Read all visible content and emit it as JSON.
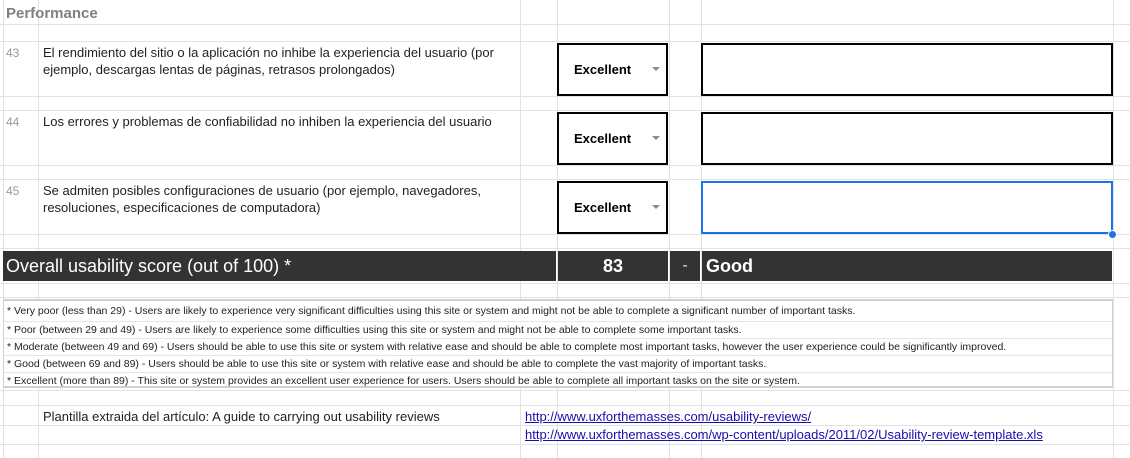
{
  "section": {
    "title": "Performance"
  },
  "rows": [
    {
      "num": "43",
      "text": "El rendimiento del sitio o la aplicación no inhibe la experiencia del usuario (por ejemplo, descargas lentas de páginas, retrasos prolongados)",
      "rating": "Excellent",
      "comment": ""
    },
    {
      "num": "44",
      "text": "Los errores y problemas de confiabilidad no inhiben la experiencia del usuario",
      "rating": "Excellent",
      "comment": ""
    },
    {
      "num": "45",
      "text": "Se admiten posibles configuraciones de usuario (por ejemplo, navegadores, resoluciones, especificaciones de computadora)",
      "rating": "Excellent",
      "comment": ""
    }
  ],
  "score": {
    "label": "Overall usability score (out of 100) *",
    "value": "83",
    "dash": "-",
    "rating": "Good"
  },
  "legend": [
    "* Very poor (less than 29) - Users are likely to experience very significant difficulties using this site or system and might not be able to complete a significant number of important tasks.",
    "* Poor (between 29 and 49) - Users are likely to experience some difficulties using this site or system and might not be able to complete some important tasks.",
    "* Moderate (between 49 and 69) - Users should be able to use this site or system with relative ease and should be able to complete most important tasks, however the user experience could be significantly improved.",
    "* Good (between 69 and 89) - Users should be able to use this site or system with relative ease and should be able to complete the vast majority of important tasks.",
    "* Excellent (more than 89) - This site or system provides an excellent user experience for users. Users should be able to complete all important tasks on the site or system."
  ],
  "source": {
    "label": "Plantilla extraida del artículo: A guide to carrying out usability reviews",
    "links": [
      "http://www.uxforthemasses.com/usability-reviews/",
      "http://www.uxforthemasses.com/wp-content/uploads/2011/02/Usability-review-template.xls"
    ]
  },
  "colors": {
    "score_bar": "#333333",
    "selection": "#1a73e8",
    "link": "#1a0dab"
  }
}
